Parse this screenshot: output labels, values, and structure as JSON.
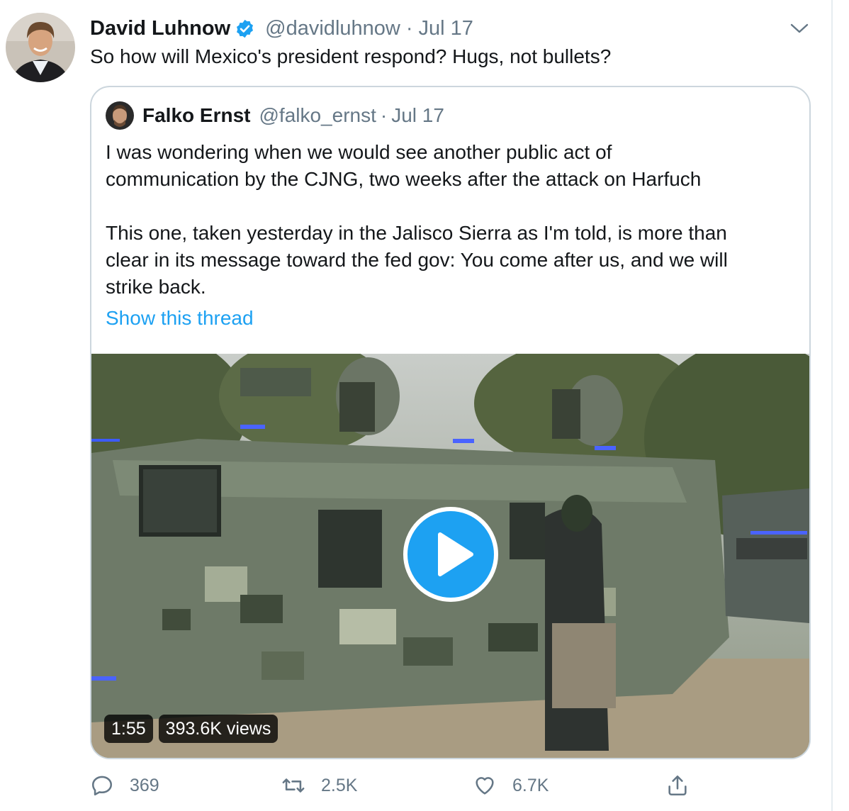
{
  "tweet": {
    "author": {
      "display_name": "David Luhnow",
      "handle": "@davidluhnow",
      "verified": true,
      "avatar_icon": "person-avatar"
    },
    "separator": "·",
    "date": "Jul 17",
    "text": "So how will Mexico's president respond? Hugs, not bullets?",
    "menu_icon": "chevron-down-icon"
  },
  "quoted": {
    "author": {
      "display_name": "Falko Ernst",
      "handle": "@falko_ernst",
      "avatar_icon": "person-avatar"
    },
    "separator": "·",
    "date": "Jul 17",
    "paragraph1": "I was wondering when we would see another public act of\ncommunication by the CJNG, two weeks after the attack on Harfuch",
    "paragraph2": "This one, taken yesterday in the Jalisco Sierra as I'm told, is more than\nclear in its message toward the fed gov: You come after us, and we will\nstrike back.",
    "show_thread": "Show this thread",
    "media": {
      "type": "video",
      "duration": "1:55",
      "views": "393.6K views",
      "play_icon": "play-icon"
    }
  },
  "actions": {
    "reply": {
      "icon": "reply-icon",
      "count": "369"
    },
    "retweet": {
      "icon": "retweet-icon",
      "count": "2.5K"
    },
    "like": {
      "icon": "heart-icon",
      "count": "6.7K"
    },
    "share": {
      "icon": "share-icon"
    }
  },
  "colors": {
    "accent": "#1da1f2",
    "muted": "#657786",
    "text": "#14171a",
    "border": "#ccd6dd"
  }
}
